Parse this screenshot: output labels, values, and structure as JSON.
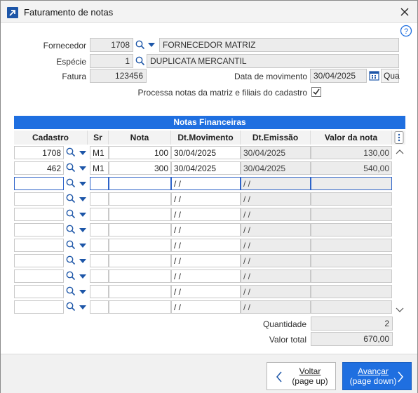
{
  "window": {
    "title": "Faturamento de notas"
  },
  "form": {
    "fornecedor_label": "Fornecedor",
    "fornecedor_code": "1708",
    "fornecedor_name": "FORNECEDOR MATRIZ",
    "especie_label": "Espécie",
    "especie_code": "1",
    "especie_name": "DUPLICATA MERCANTIL",
    "fatura_label": "Fatura",
    "fatura_value": "123456",
    "data_mov_label": "Data de movimento",
    "data_mov_value": "30/04/2025",
    "qua_button": "Qua",
    "processa_label": "Processa notas da matriz e filiais do cadastro",
    "processa_checked": true
  },
  "grid": {
    "title": "Notas Financeiras",
    "columns": [
      "Cadastro",
      "Sr",
      "Nota",
      "Dt.Movimento",
      "Dt.Emissão",
      "Valor da nota"
    ],
    "rows": [
      {
        "cadastro": "1708",
        "sr": "M1",
        "nota": "100",
        "dt_mov": "30/04/2025",
        "dt_emis": "30/04/2025",
        "valor": "130,00"
      },
      {
        "cadastro": "462",
        "sr": "M1",
        "nota": "300",
        "dt_mov": "30/04/2025",
        "dt_emis": "30/04/2025",
        "valor": "540,00"
      },
      {
        "cadastro": "",
        "sr": "",
        "nota": "",
        "dt_mov": " /  /",
        "dt_emis": " /  /",
        "valor": ""
      },
      {
        "cadastro": "",
        "sr": "",
        "nota": "",
        "dt_mov": " /  /",
        "dt_emis": " /  /",
        "valor": ""
      },
      {
        "cadastro": "",
        "sr": "",
        "nota": "",
        "dt_mov": " /  /",
        "dt_emis": " /  /",
        "valor": ""
      },
      {
        "cadastro": "",
        "sr": "",
        "nota": "",
        "dt_mov": " /  /",
        "dt_emis": " /  /",
        "valor": ""
      },
      {
        "cadastro": "",
        "sr": "",
        "nota": "",
        "dt_mov": " /  /",
        "dt_emis": " /  /",
        "valor": ""
      },
      {
        "cadastro": "",
        "sr": "",
        "nota": "",
        "dt_mov": " /  /",
        "dt_emis": " /  /",
        "valor": ""
      },
      {
        "cadastro": "",
        "sr": "",
        "nota": "",
        "dt_mov": " /  /",
        "dt_emis": " /  /",
        "valor": ""
      },
      {
        "cadastro": "",
        "sr": "",
        "nota": "",
        "dt_mov": " /  /",
        "dt_emis": " /  /",
        "valor": ""
      },
      {
        "cadastro": "",
        "sr": "",
        "nota": "",
        "dt_mov": " /  /",
        "dt_emis": " /  /",
        "valor": ""
      }
    ]
  },
  "totals": {
    "quantidade_label": "Quantidade",
    "quantidade_value": "2",
    "valor_total_label": "Valor total",
    "valor_total_value": "670,00"
  },
  "footer": {
    "voltar_label": "Voltar",
    "voltar_hint": "(page up)",
    "avancar_label": "Avançar",
    "avancar_hint": "(page down)"
  },
  "colors": {
    "accent": "#1f6fe0",
    "icon_blue": "#1d56a8"
  },
  "icons": [
    "app-icon",
    "close-icon",
    "help-icon",
    "search-icon",
    "chevron-down-icon",
    "calendar-icon",
    "kebab-menu-icon",
    "chevron-up-icon",
    "chevron-left-icon",
    "chevron-right-icon"
  ]
}
